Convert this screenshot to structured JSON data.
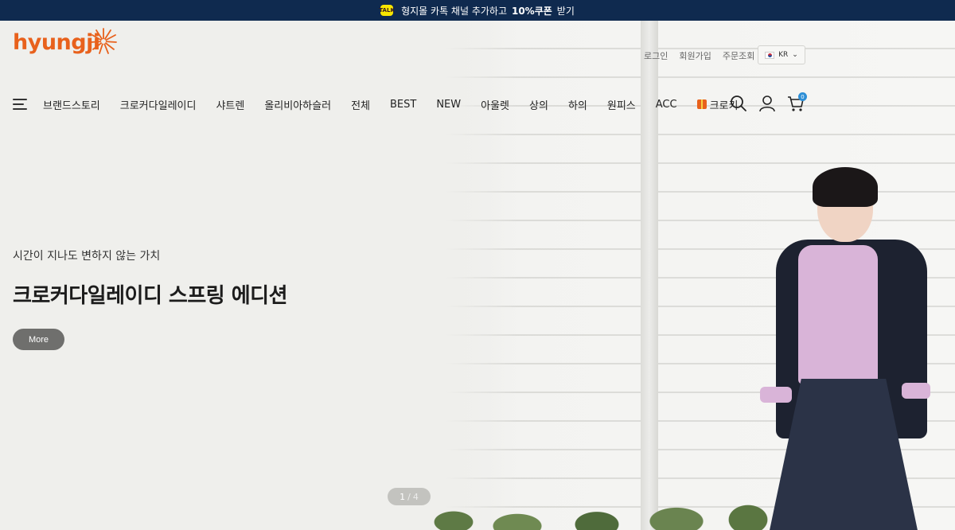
{
  "topbar": {
    "text_before": "형지몰 카톡 채널 추가하고",
    "highlight": "10%쿠폰",
    "text_after": "받기",
    "kakao_label": "TALK"
  },
  "header": {
    "logo_text": "hyungji",
    "util_links": [
      "로그인",
      "회원가입",
      "주문조회"
    ],
    "language": "KR",
    "cart_count": "0"
  },
  "nav": {
    "items": [
      "브랜드스토리",
      "크로커다일레이디",
      "샤트렌",
      "올리비아하슬러",
      "전체",
      "BEST",
      "NEW",
      "아울렛",
      "상의",
      "하의",
      "원피스",
      "ACC"
    ],
    "special_label": "크로키"
  },
  "hero": {
    "subtitle": "시간이 지나도 변하지 않는 가치",
    "title": "크로커다일레이디 스프링 에디션",
    "more_label": "More",
    "page_current": "1",
    "page_sep": "/",
    "page_total": "4"
  },
  "colors": {
    "topbar_bg": "#0f2a4f",
    "brand_orange": "#e8611c",
    "badge_blue": "#2e8fd6"
  }
}
